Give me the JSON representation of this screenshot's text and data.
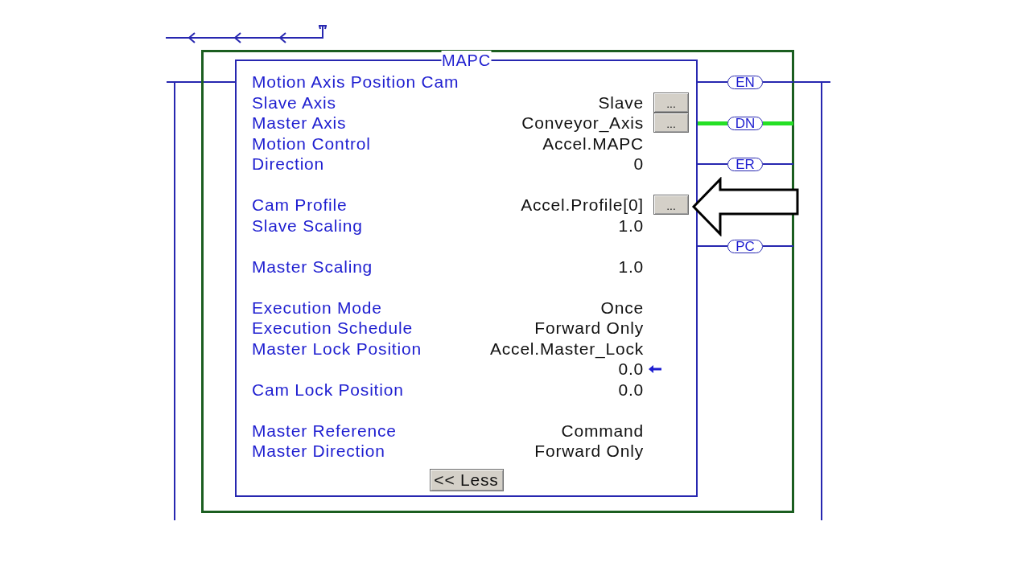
{
  "rung": {
    "instruction": {
      "mnemonic": "MAPC",
      "description": "Motion Axis Position Cam",
      "parameter_groups": [
        {
          "parameters": [
            {
              "label": "Slave Axis",
              "value": "Slave",
              "button": "..."
            },
            {
              "label": "Master Axis",
              "value": "Conveyor_Axis",
              "button": "..."
            },
            {
              "label": "Motion Control",
              "value": "Accel.MAPC"
            },
            {
              "label": "Direction",
              "value": "0"
            }
          ]
        },
        {
          "parameters": [
            {
              "label": "Cam Profile",
              "value": "Accel.Profile[0]",
              "button": "..."
            },
            {
              "label": "Slave Scaling",
              "value": "1.0"
            }
          ]
        },
        {
          "parameters": [
            {
              "label": "Master Scaling",
              "value": "1.0"
            }
          ]
        },
        {
          "parameters": [
            {
              "label": "Execution Mode",
              "value": "Once"
            },
            {
              "label": "Execution Schedule",
              "value": "Forward Only"
            },
            {
              "label": "Master Lock Position",
              "value": "Accel.Master_Lock",
              "live_value": "0.0"
            },
            {
              "label": "Cam Lock Position",
              "value": "0.0"
            }
          ]
        },
        {
          "parameters": [
            {
              "label": "Master Reference",
              "value": "Command"
            },
            {
              "label": "Master Direction",
              "value": "Forward Only"
            }
          ]
        }
      ],
      "less_button": "<< Less"
    },
    "outputs": [
      {
        "label": "EN",
        "energized": false
      },
      {
        "label": "DN",
        "energized": true
      },
      {
        "label": "ER",
        "energized": false
      },
      {
        "label": "PC",
        "energized": false
      }
    ]
  }
}
